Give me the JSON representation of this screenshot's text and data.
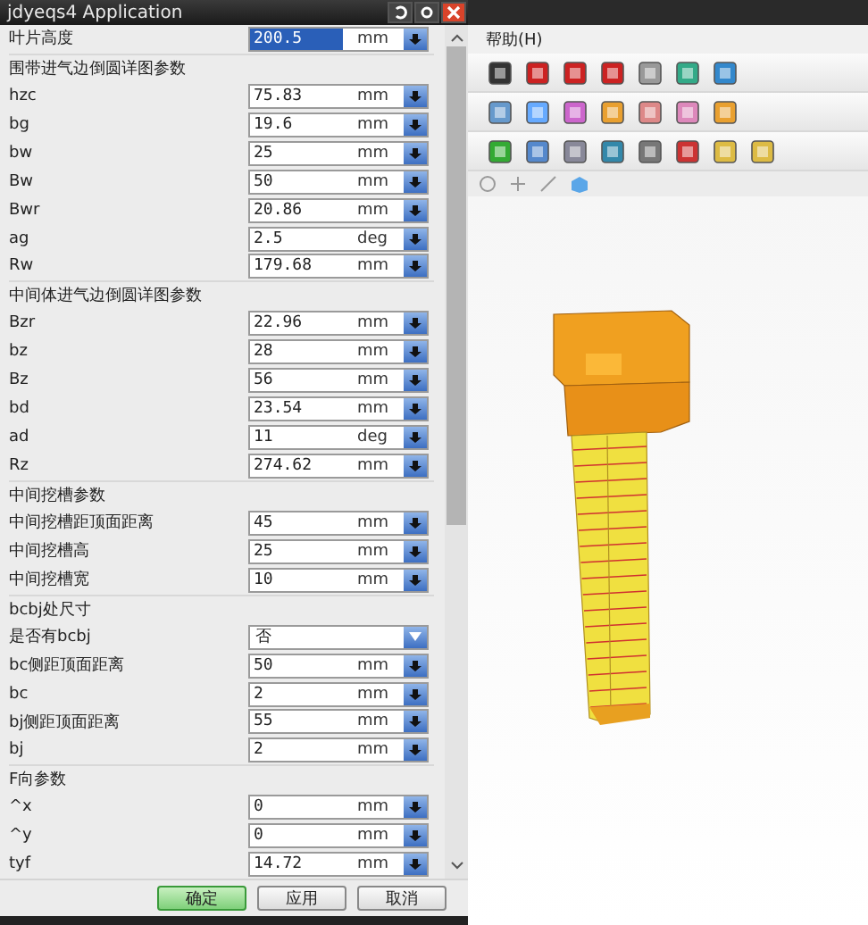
{
  "dialog": {
    "title": "jdyeqs4 Application",
    "top_field": {
      "label": "叶片高度",
      "value": "200.5",
      "unit": "mm",
      "kind": "number",
      "selected": true
    },
    "sections": [
      {
        "title": "围带进气边倒圆详图参数",
        "fields": [
          {
            "label": "hzc",
            "value": "75.83",
            "unit": "mm",
            "kind": "number",
            "selected": false
          },
          {
            "label": "bg",
            "value": "19.6",
            "unit": "mm",
            "kind": "number",
            "selected": false
          },
          {
            "label": "bw",
            "value": "25",
            "unit": "mm",
            "kind": "number",
            "selected": false
          },
          {
            "label": "Bw",
            "value": "50",
            "unit": "mm",
            "kind": "number",
            "selected": false
          },
          {
            "label": "Bwr",
            "value": "20.86",
            "unit": "mm",
            "kind": "number",
            "selected": false
          },
          {
            "label": "ag",
            "value": "2.5",
            "unit": "deg",
            "kind": "number",
            "selected": false
          },
          {
            "label": "Rw",
            "value": "179.68",
            "unit": "mm",
            "kind": "number",
            "selected": false
          }
        ]
      },
      {
        "title": "中间体进气边倒圆详图参数",
        "fields": [
          {
            "label": "Bzr",
            "value": "22.96",
            "unit": "mm",
            "kind": "number",
            "selected": false
          },
          {
            "label": "bz",
            "value": "28",
            "unit": "mm",
            "kind": "number",
            "selected": false
          },
          {
            "label": "Bz",
            "value": "56",
            "unit": "mm",
            "kind": "number",
            "selected": false
          },
          {
            "label": "bd",
            "value": "23.54",
            "unit": "mm",
            "kind": "number",
            "selected": false
          },
          {
            "label": "ad",
            "value": "11",
            "unit": "deg",
            "kind": "number",
            "selected": false
          },
          {
            "label": "Rz",
            "value": "274.62",
            "unit": "mm",
            "kind": "number",
            "selected": false
          }
        ]
      },
      {
        "title": "中间挖槽参数",
        "fields": [
          {
            "label": "中间挖槽距顶面距离",
            "value": "45",
            "unit": "mm",
            "kind": "number",
            "selected": false
          },
          {
            "label": "中间挖槽高",
            "value": "25",
            "unit": "mm",
            "kind": "number",
            "selected": false
          },
          {
            "label": "中间挖槽宽",
            "value": "10",
            "unit": "mm",
            "kind": "number",
            "selected": false
          }
        ]
      },
      {
        "title": "bcbj处尺寸",
        "fields": [
          {
            "label": "是否有bcbj",
            "value": "否",
            "kind": "dropdown",
            "selected": false
          },
          {
            "label": "bc侧距顶面距离",
            "value": "50",
            "unit": "mm",
            "kind": "number",
            "selected": false
          },
          {
            "label": "bc",
            "value": "2",
            "unit": "mm",
            "kind": "number",
            "selected": false
          },
          {
            "label": "bj侧距顶面距离",
            "value": "55",
            "unit": "mm",
            "kind": "number",
            "selected": false
          },
          {
            "label": "bj",
            "value": "2",
            "unit": "mm",
            "kind": "number",
            "selected": false
          }
        ]
      },
      {
        "title": "F向参数",
        "fields": [
          {
            "label": "^x",
            "value": "0",
            "unit": "mm",
            "kind": "number",
            "selected": false
          },
          {
            "label": "^y",
            "value": "0",
            "unit": "mm",
            "kind": "number",
            "selected": false
          },
          {
            "label": "tyf",
            "value": "14.72",
            "unit": "mm",
            "kind": "number",
            "selected": false
          }
        ]
      }
    ],
    "buttons": [
      {
        "label": "确定",
        "default": true
      },
      {
        "label": "应用",
        "default": false
      },
      {
        "label": "取消",
        "default": false
      }
    ]
  },
  "cad": {
    "menu": "帮助(H)"
  }
}
